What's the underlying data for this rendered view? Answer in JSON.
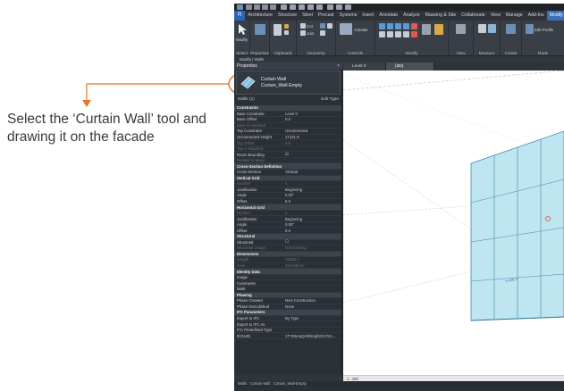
{
  "callout": {
    "text": "Select the ‘Curtain Wall’ tool and drawing it on the facade",
    "accent_color": "#e8762b"
  },
  "menu": {
    "file": "R",
    "items": [
      "Architecture",
      "Structure",
      "Steel",
      "Precast",
      "Systems",
      "Insert",
      "Annotate",
      "Analyze",
      "Massing & Site",
      "Collaborate",
      "View",
      "Manage",
      "Add-Ins",
      "Modify | Walls"
    ]
  },
  "ribbon": {
    "groups": [
      "Select",
      "Properties",
      "Clipboard",
      "Geometry",
      "Controls",
      "Modify",
      "View",
      "Measure",
      "Create",
      "Mode"
    ],
    "modify_label": "Modify",
    "activate_label": "Activate",
    "edit_profile_label": "Edit Profile",
    "cut_label": "Cut",
    "join_label": "Join"
  },
  "options_bar": {
    "label": "Modify | Walls"
  },
  "properties": {
    "header": "Properties",
    "close": "×",
    "type_name": "Curtain Wall",
    "type_sub": "Curtain_Wall-Empty",
    "instance_label": "Walls (1)",
    "edit_type_label": "Edit Type",
    "rows": [
      {
        "label": "Constraints",
        "value": "",
        "kind": "sect"
      },
      {
        "label": "Base Constraint",
        "value": "Level 0",
        "kind": "row"
      },
      {
        "label": "Base Offset",
        "value": "0.0",
        "kind": "row"
      },
      {
        "label": "Base is Attached",
        "value": "",
        "kind": "dim"
      },
      {
        "label": "Top Constraint",
        "value": "Unconnected",
        "kind": "row"
      },
      {
        "label": "Unconnected Height",
        "value": "17121.9",
        "kind": "row"
      },
      {
        "label": "Top Offset",
        "value": "0.0",
        "kind": "dim"
      },
      {
        "label": "Top is Attached",
        "value": "",
        "kind": "dim"
      },
      {
        "label": "Room Bounding",
        "value": "☑",
        "kind": "row"
      },
      {
        "label": "Related to Mass",
        "value": "",
        "kind": "dim"
      },
      {
        "label": "Cross-Section Definition",
        "value": "",
        "kind": "sect"
      },
      {
        "label": "Cross-Section",
        "value": "Vertical",
        "kind": "row"
      },
      {
        "label": "Vertical Grid",
        "value": "",
        "kind": "sect"
      },
      {
        "label": "Number",
        "value": "4",
        "kind": "dim"
      },
      {
        "label": "Justification",
        "value": "Beginning",
        "kind": "row"
      },
      {
        "label": "Angle",
        "value": "0.00°",
        "kind": "row"
      },
      {
        "label": "Offset",
        "value": "0.0",
        "kind": "row"
      },
      {
        "label": "Horizontal Grid",
        "value": "",
        "kind": "sect"
      },
      {
        "label": "Number",
        "value": "4",
        "kind": "dim"
      },
      {
        "label": "Justification",
        "value": "Beginning",
        "kind": "row"
      },
      {
        "label": "Angle",
        "value": "0.00°",
        "kind": "row"
      },
      {
        "label": "Offset",
        "value": "0.0",
        "kind": "row"
      },
      {
        "label": "Structural",
        "value": "",
        "kind": "sect"
      },
      {
        "label": "Structural",
        "value": "☐",
        "kind": "row"
      },
      {
        "label": "Structural Usage",
        "value": "Non-bearing",
        "kind": "dim"
      },
      {
        "label": "Dimensions",
        "value": "",
        "kind": "sect"
      },
      {
        "label": "Length",
        "value": "18335.1",
        "kind": "dim"
      },
      {
        "label": "Area",
        "value": "313.940 m²",
        "kind": "dim"
      },
      {
        "label": "Identity Data",
        "value": "",
        "kind": "sect"
      },
      {
        "label": "Image",
        "value": "",
        "kind": "row"
      },
      {
        "label": "Comments",
        "value": "",
        "kind": "row"
      },
      {
        "label": "Mark",
        "value": "",
        "kind": "row"
      },
      {
        "label": "Phasing",
        "value": "",
        "kind": "sect"
      },
      {
        "label": "Phase Created",
        "value": "New Construction",
        "kind": "row"
      },
      {
        "label": "Phase Demolished",
        "value": "None",
        "kind": "row"
      },
      {
        "label": "IFC Parameters",
        "value": "",
        "kind": "sect"
      },
      {
        "label": "Export to IFC",
        "value": "By Type",
        "kind": "row"
      },
      {
        "label": "Export to IFC As",
        "value": "",
        "kind": "row"
      },
      {
        "label": "IFC Predefined Type",
        "value": "",
        "kind": "row"
      },
      {
        "label": "IfcGUID",
        "value": "1TYB5AqQHBhnghSOcTcC...",
        "kind": "row"
      }
    ]
  },
  "views": {
    "tab1": "Level 0",
    "tab2": "{3D}",
    "grid_color": "#9fd4e3",
    "label_tag": "TYPE 1"
  },
  "view_control": {
    "scale": "1 : 100"
  },
  "status": {
    "text": "Walls : Curtain Wall : Curtain_Wall-Empty"
  }
}
